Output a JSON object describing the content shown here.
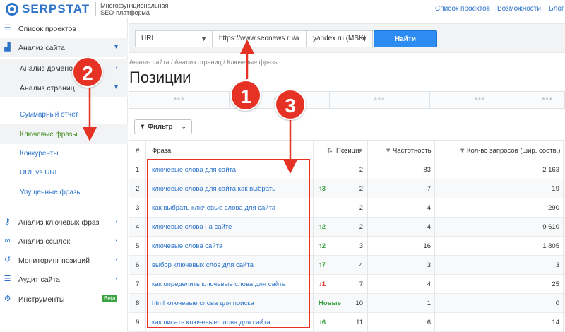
{
  "header": {
    "logo_text": "SERPSTAT",
    "logo_sub_1": "Многофункциональная",
    "logo_sub_2": "SEO-платформа",
    "nav": [
      "Список проектов",
      "Возможности",
      "Блог"
    ]
  },
  "sidebar": {
    "projects": "Список проектов",
    "site_analysis": "Анализ сайта",
    "domain_analysis": "Анализ доменов",
    "page_analysis": "Анализ страниц",
    "sub_items": [
      "Суммарный отчет",
      "Ключевые фразы",
      "Конкуренты",
      "URL vs URL",
      "Упущенные фразы"
    ],
    "keyword_analysis": "Анализ ключевых фраз",
    "link_analysis": "Анализ ссылок",
    "rank_tracking": "Мониторинг позиций",
    "site_audit": "Аудит сайта",
    "tools": "Инструменты",
    "beta": "Beta"
  },
  "search": {
    "type": "URL",
    "url": "https://www.seonews.ru/a",
    "engine": "yandex.ru (MSK)",
    "button": "Найти"
  },
  "breadcrumb": "Анализ сайта / Анализ страниц / Ключевые фразы",
  "page_title": "Позиции",
  "summary_placeholder": "•••",
  "filter_label": "Фильтр",
  "table": {
    "headers": {
      "num": "#",
      "phrase": "Фраза",
      "position": "Позиция",
      "frequency": "Частотность",
      "results": "Кол-во запросов (шир. соотв.)"
    },
    "rows": [
      {
        "n": "1",
        "phrase": "ключевые слова для сайта",
        "change": "",
        "dir": "",
        "pos": "2",
        "freq": "83",
        "res": "2 163"
      },
      {
        "n": "2",
        "phrase": "ключевые слова для сайта как выбрать",
        "change": "3",
        "dir": "up",
        "pos": "2",
        "freq": "7",
        "res": "19"
      },
      {
        "n": "3",
        "phrase": "как выбрать ключевые слова для сайта",
        "change": "",
        "dir": "",
        "pos": "2",
        "freq": "4",
        "res": "290"
      },
      {
        "n": "4",
        "phrase": "ключевые слова на сайте",
        "change": "2",
        "dir": "up",
        "pos": "2",
        "freq": "4",
        "res": "9 610"
      },
      {
        "n": "5",
        "phrase": "ключевые слова сайта",
        "change": "2",
        "dir": "up",
        "pos": "3",
        "freq": "16",
        "res": "1 805"
      },
      {
        "n": "6",
        "phrase": "выбор ключевых слов для сайта",
        "change": "7",
        "dir": "up",
        "pos": "4",
        "freq": "3",
        "res": "3"
      },
      {
        "n": "7",
        "phrase": "как определить ключевые слова для сайта",
        "change": "1",
        "dir": "down",
        "pos": "7",
        "freq": "4",
        "res": "25"
      },
      {
        "n": "8",
        "phrase": "html ключевые слова для поиска",
        "change": "Новые",
        "dir": "new",
        "pos": "10",
        "freq": "1",
        "res": "0"
      },
      {
        "n": "9",
        "phrase": "как писать ключевые слова для сайта",
        "change": "6",
        "dir": "up",
        "pos": "11",
        "freq": "6",
        "res": "14"
      }
    ]
  },
  "annotations": [
    "1",
    "2",
    "3"
  ],
  "colors": {
    "accent": "#2c73c9",
    "button": "#2c8cf1",
    "annotation": "#e53224",
    "up": "#3aa442",
    "down": "#d9362f"
  }
}
